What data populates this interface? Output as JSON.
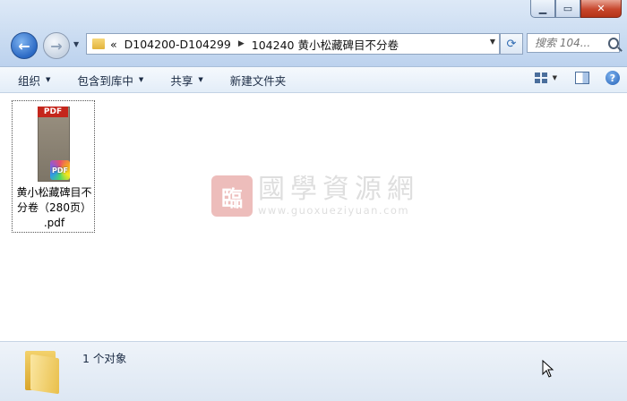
{
  "address": {
    "overflow": "«",
    "parts": [
      "D104200-D104299",
      "104240 黄小松藏碑目不分卷"
    ]
  },
  "search": {
    "placeholder": "搜索 104..."
  },
  "toolbar": {
    "organize": "组织",
    "include_library": "包含到库中",
    "share": "共享",
    "new_folder": "新建文件夹"
  },
  "file": {
    "name_line1": "黄小松藏碑目不",
    "name_line2": "分卷（280页）",
    "name_line3": ".pdf",
    "thumb_label": "PDF",
    "badge": "PDF"
  },
  "watermark": {
    "title": "國學資源網",
    "url": "www.guoxueziyuan.com"
  },
  "status": {
    "count_text": "1 个对象"
  },
  "icons": [
    "back-arrow-icon",
    "forward-arrow-icon",
    "folder-icon",
    "refresh-icon",
    "search-icon",
    "view-options-icon",
    "preview-pane-icon",
    "help-icon",
    "pdf-file-icon",
    "large-folder-icon",
    "mouse-cursor-icon"
  ]
}
